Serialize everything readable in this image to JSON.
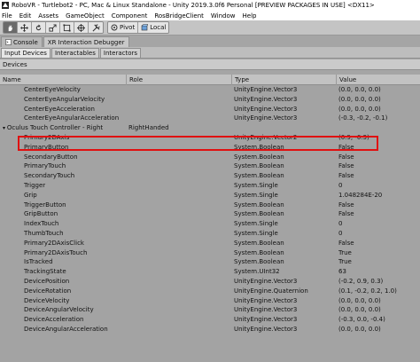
{
  "titlebar": {
    "title": "RoboVR - Turtlebot2 - PC, Mac & Linux Standalone - Unity 2019.3.0f6 Personal [PREVIEW PACKAGES IN USE] <DX11>"
  },
  "menubar": {
    "items": [
      "File",
      "Edit",
      "Assets",
      "GameObject",
      "Component",
      "RosBridgeClient",
      "Window",
      "Help"
    ]
  },
  "toolbar": {
    "tools": [
      "hand-icon",
      "move-icon",
      "rotate-icon",
      "scale-icon",
      "rect-icon",
      "transform-icon",
      "tools-icon"
    ],
    "pivot_label": "Pivot",
    "local_label": "Local"
  },
  "window_tabs": [
    "Console",
    "XR Interaction Debugger"
  ],
  "sub_tabs": [
    "Input Devices",
    "Interactables",
    "Interactors"
  ],
  "section_label": "Devices",
  "columns": {
    "name": "Name",
    "role": "Role",
    "type": "Type",
    "value": "Value"
  },
  "rows": [
    {
      "name": "CenterEyeVelocity",
      "role": "",
      "type": "UnityEngine.Vector3",
      "value": "(0.0, 0.0, 0.0)",
      "indent": 2
    },
    {
      "name": "CenterEyeAngularVelocity",
      "role": "",
      "type": "UnityEngine.Vector3",
      "value": "(0.0, 0.0, 0.0)",
      "indent": 2
    },
    {
      "name": "CenterEyeAcceleration",
      "role": "",
      "type": "UnityEngine.Vector3",
      "value": "(0.0, 0.0, 0.0)",
      "indent": 2
    },
    {
      "name": "CenterEyeAngularAcceleration",
      "role": "",
      "type": "UnityEngine.Vector3",
      "value": "(-0.3, -0.2, -0.1)",
      "indent": 2
    },
    {
      "name": "Oculus Touch Controller - Right",
      "role": "RightHanded",
      "type": "",
      "value": "",
      "indent": 1,
      "expander": true
    },
    {
      "name": "Primary2DAxis",
      "role": "",
      "type": "UnityEngine.Vector2",
      "value": "(0.9, -0.3)",
      "indent": 2
    },
    {
      "name": "PrimaryButton",
      "role": "",
      "type": "System.Boolean",
      "value": "False",
      "indent": 2
    },
    {
      "name": "SecondaryButton",
      "role": "",
      "type": "System.Boolean",
      "value": "False",
      "indent": 2
    },
    {
      "name": "PrimaryTouch",
      "role": "",
      "type": "System.Boolean",
      "value": "False",
      "indent": 2
    },
    {
      "name": "SecondaryTouch",
      "role": "",
      "type": "System.Boolean",
      "value": "False",
      "indent": 2
    },
    {
      "name": "Trigger",
      "role": "",
      "type": "System.Single",
      "value": "0",
      "indent": 2
    },
    {
      "name": "Grip",
      "role": "",
      "type": "System.Single",
      "value": "1.048284E-20",
      "indent": 2
    },
    {
      "name": "TriggerButton",
      "role": "",
      "type": "System.Boolean",
      "value": "False",
      "indent": 2
    },
    {
      "name": "GripButton",
      "role": "",
      "type": "System.Boolean",
      "value": "False",
      "indent": 2
    },
    {
      "name": "IndexTouch",
      "role": "",
      "type": "System.Single",
      "value": "0",
      "indent": 2
    },
    {
      "name": "ThumbTouch",
      "role": "",
      "type": "System.Single",
      "value": "0",
      "indent": 2
    },
    {
      "name": "Primary2DAxisClick",
      "role": "",
      "type": "System.Boolean",
      "value": "False",
      "indent": 2
    },
    {
      "name": "Primary2DAxisTouch",
      "role": "",
      "type": "System.Boolean",
      "value": "True",
      "indent": 2
    },
    {
      "name": "IsTracked",
      "role": "",
      "type": "System.Boolean",
      "value": "True",
      "indent": 2
    },
    {
      "name": "TrackingState",
      "role": "",
      "type": "System.UInt32",
      "value": "63",
      "indent": 2
    },
    {
      "name": "DevicePosition",
      "role": "",
      "type": "UnityEngine.Vector3",
      "value": "(-0.2, 0.9, 0.3)",
      "indent": 2
    },
    {
      "name": "DeviceRotation",
      "role": "",
      "type": "UnityEngine.Quaternion",
      "value": "(0.1, -0.2, 0.2, 1.0)",
      "indent": 2
    },
    {
      "name": "DeviceVelocity",
      "role": "",
      "type": "UnityEngine.Vector3",
      "value": "(0.0, 0.0, 0.0)",
      "indent": 2
    },
    {
      "name": "DeviceAngularVelocity",
      "role": "",
      "type": "UnityEngine.Vector3",
      "value": "(0.0, 0.0, 0.0)",
      "indent": 2
    },
    {
      "name": "DeviceAcceleration",
      "role": "",
      "type": "UnityEngine.Vector3",
      "value": "(-0.3, 0.0, -0.4)",
      "indent": 2
    },
    {
      "name": "DeviceAngularAcceleration",
      "role": "",
      "type": "UnityEngine.Vector3",
      "value": "(0.0, 0.0, 0.0)",
      "indent": 2
    }
  ],
  "highlight": {
    "row": "Primary2DAxis",
    "color": "#e01010"
  },
  "colors": {
    "selected_tab": "#e6e6e6",
    "panel": "#a3a3a3"
  }
}
